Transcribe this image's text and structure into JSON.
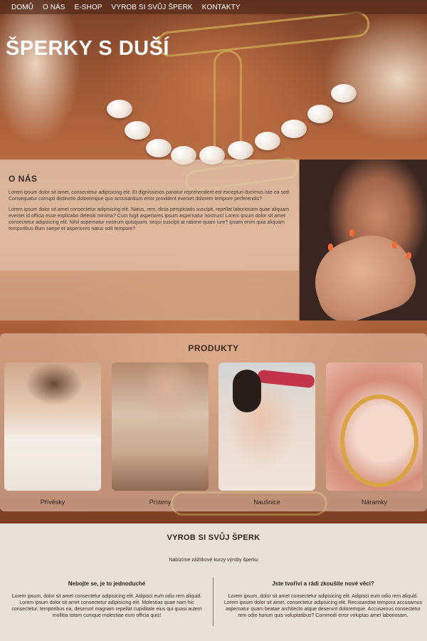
{
  "nav": {
    "items": [
      "DOMŮ",
      "O NÁS",
      "E-SHOP",
      "VYROB SI SVŮJ ŠPERK",
      "KONTAKTY"
    ]
  },
  "hero": {
    "title": "ŠPERKY S DUŠÍ"
  },
  "about": {
    "heading": "O NÁS",
    "paragraphs": [
      "Lorem ipsum dolor sit amet, consectetur adipisicing elit. Et dignissimos pariatur reprehenderit est excepturi ducimus iste ea sed. Consequatur corrupti distinctio doloremque quo accusantium error provident eveniet dolorem tempore perferendis?",
      "Lorem ipsum dolor sit amet consectetur adipisicing elit. Natus, rem, dicta perspiciatis suscipit, repellat laboriosam quae aliquam eveniet id officia esse explicabo deleniti minima? Cum fugit asperiores ipsum aspernatur nostrum! Lorem ipsum dolor sit amet consectetur adipisicing elit. Nihil aspernatur nostrum quisquam, sequi suscipit at ratione quam iure? Ipsam enim quia aliquam temporibus illum saepe et asperiores natus odit tempore?"
    ]
  },
  "products": {
    "heading": "PRODUKTY",
    "items": [
      {
        "label": "Přívěsky"
      },
      {
        "label": "Prsteny"
      },
      {
        "label": "Naušnice"
      },
      {
        "label": "Náramky"
      }
    ]
  },
  "workshop": {
    "heading": "VYROB SI SVŮJ ŠPERK",
    "subtitle": "Nabízíme zážitkové kurzy výroby šperku",
    "left": {
      "heading": "Nebojte se, je to jednoduché",
      "text": "Lorem ipsum, dolor sit amet consectetur adipisicing elit. Adipisci eum odio rem aliquid. Lorem ipsum dolor sit amet consectetur adipisicing elit. Molestias quae nam hic consectetur, temporibus ea, deserunt magnam repellat cupiditate eius qui quasi autem mollitia totam cumque molestiae eum officia quis!"
    },
    "right": {
      "heading": "Jste tvořiví a rádi zkoušíte nové věci?",
      "text": "Lorem ipsum, dolor sit amet consectetur adipisicing elit. Adipisci eum odio rem aliquid. Lorem ipsum dolor sit amet, consectetur adipisicing elit. Recusandae tempora accusamus aspernatur quam beatae architecto atque deserunt doloremque. Accusamus consectetur rem odio harum quis voluptatibus? Commodi error voluptas amet laboriosam."
    }
  }
}
